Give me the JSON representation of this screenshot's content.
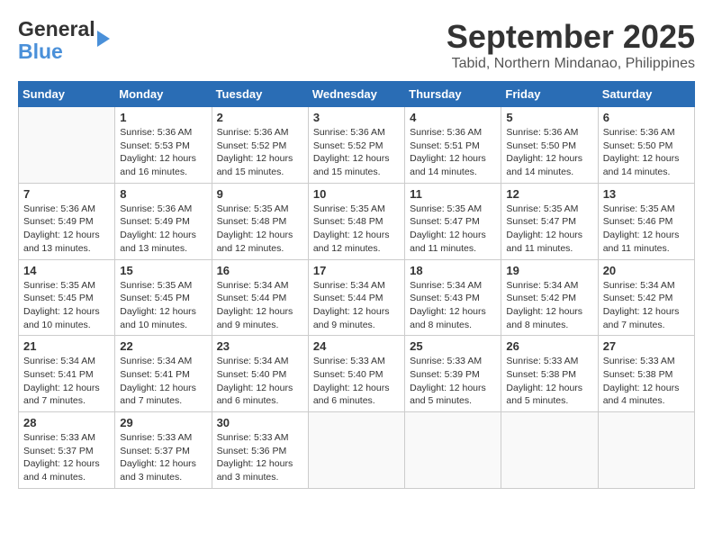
{
  "logo": {
    "part1": "General",
    "part2": "Blue"
  },
  "title": "September 2025",
  "location": "Tabid, Northern Mindanao, Philippines",
  "days_of_week": [
    "Sunday",
    "Monday",
    "Tuesday",
    "Wednesday",
    "Thursday",
    "Friday",
    "Saturday"
  ],
  "weeks": [
    [
      {
        "day": "",
        "info": ""
      },
      {
        "day": "1",
        "info": "Sunrise: 5:36 AM\nSunset: 5:53 PM\nDaylight: 12 hours\nand 16 minutes."
      },
      {
        "day": "2",
        "info": "Sunrise: 5:36 AM\nSunset: 5:52 PM\nDaylight: 12 hours\nand 15 minutes."
      },
      {
        "day": "3",
        "info": "Sunrise: 5:36 AM\nSunset: 5:52 PM\nDaylight: 12 hours\nand 15 minutes."
      },
      {
        "day": "4",
        "info": "Sunrise: 5:36 AM\nSunset: 5:51 PM\nDaylight: 12 hours\nand 14 minutes."
      },
      {
        "day": "5",
        "info": "Sunrise: 5:36 AM\nSunset: 5:50 PM\nDaylight: 12 hours\nand 14 minutes."
      },
      {
        "day": "6",
        "info": "Sunrise: 5:36 AM\nSunset: 5:50 PM\nDaylight: 12 hours\nand 14 minutes."
      }
    ],
    [
      {
        "day": "7",
        "info": "Sunrise: 5:36 AM\nSunset: 5:49 PM\nDaylight: 12 hours\nand 13 minutes."
      },
      {
        "day": "8",
        "info": "Sunrise: 5:36 AM\nSunset: 5:49 PM\nDaylight: 12 hours\nand 13 minutes."
      },
      {
        "day": "9",
        "info": "Sunrise: 5:35 AM\nSunset: 5:48 PM\nDaylight: 12 hours\nand 12 minutes."
      },
      {
        "day": "10",
        "info": "Sunrise: 5:35 AM\nSunset: 5:48 PM\nDaylight: 12 hours\nand 12 minutes."
      },
      {
        "day": "11",
        "info": "Sunrise: 5:35 AM\nSunset: 5:47 PM\nDaylight: 12 hours\nand 11 minutes."
      },
      {
        "day": "12",
        "info": "Sunrise: 5:35 AM\nSunset: 5:47 PM\nDaylight: 12 hours\nand 11 minutes."
      },
      {
        "day": "13",
        "info": "Sunrise: 5:35 AM\nSunset: 5:46 PM\nDaylight: 12 hours\nand 11 minutes."
      }
    ],
    [
      {
        "day": "14",
        "info": "Sunrise: 5:35 AM\nSunset: 5:45 PM\nDaylight: 12 hours\nand 10 minutes."
      },
      {
        "day": "15",
        "info": "Sunrise: 5:35 AM\nSunset: 5:45 PM\nDaylight: 12 hours\nand 10 minutes."
      },
      {
        "day": "16",
        "info": "Sunrise: 5:34 AM\nSunset: 5:44 PM\nDaylight: 12 hours\nand 9 minutes."
      },
      {
        "day": "17",
        "info": "Sunrise: 5:34 AM\nSunset: 5:44 PM\nDaylight: 12 hours\nand 9 minutes."
      },
      {
        "day": "18",
        "info": "Sunrise: 5:34 AM\nSunset: 5:43 PM\nDaylight: 12 hours\nand 8 minutes."
      },
      {
        "day": "19",
        "info": "Sunrise: 5:34 AM\nSunset: 5:42 PM\nDaylight: 12 hours\nand 8 minutes."
      },
      {
        "day": "20",
        "info": "Sunrise: 5:34 AM\nSunset: 5:42 PM\nDaylight: 12 hours\nand 7 minutes."
      }
    ],
    [
      {
        "day": "21",
        "info": "Sunrise: 5:34 AM\nSunset: 5:41 PM\nDaylight: 12 hours\nand 7 minutes."
      },
      {
        "day": "22",
        "info": "Sunrise: 5:34 AM\nSunset: 5:41 PM\nDaylight: 12 hours\nand 7 minutes."
      },
      {
        "day": "23",
        "info": "Sunrise: 5:34 AM\nSunset: 5:40 PM\nDaylight: 12 hours\nand 6 minutes."
      },
      {
        "day": "24",
        "info": "Sunrise: 5:33 AM\nSunset: 5:40 PM\nDaylight: 12 hours\nand 6 minutes."
      },
      {
        "day": "25",
        "info": "Sunrise: 5:33 AM\nSunset: 5:39 PM\nDaylight: 12 hours\nand 5 minutes."
      },
      {
        "day": "26",
        "info": "Sunrise: 5:33 AM\nSunset: 5:38 PM\nDaylight: 12 hours\nand 5 minutes."
      },
      {
        "day": "27",
        "info": "Sunrise: 5:33 AM\nSunset: 5:38 PM\nDaylight: 12 hours\nand 4 minutes."
      }
    ],
    [
      {
        "day": "28",
        "info": "Sunrise: 5:33 AM\nSunset: 5:37 PM\nDaylight: 12 hours\nand 4 minutes."
      },
      {
        "day": "29",
        "info": "Sunrise: 5:33 AM\nSunset: 5:37 PM\nDaylight: 12 hours\nand 3 minutes."
      },
      {
        "day": "30",
        "info": "Sunrise: 5:33 AM\nSunset: 5:36 PM\nDaylight: 12 hours\nand 3 minutes."
      },
      {
        "day": "",
        "info": ""
      },
      {
        "day": "",
        "info": ""
      },
      {
        "day": "",
        "info": ""
      },
      {
        "day": "",
        "info": ""
      }
    ]
  ]
}
